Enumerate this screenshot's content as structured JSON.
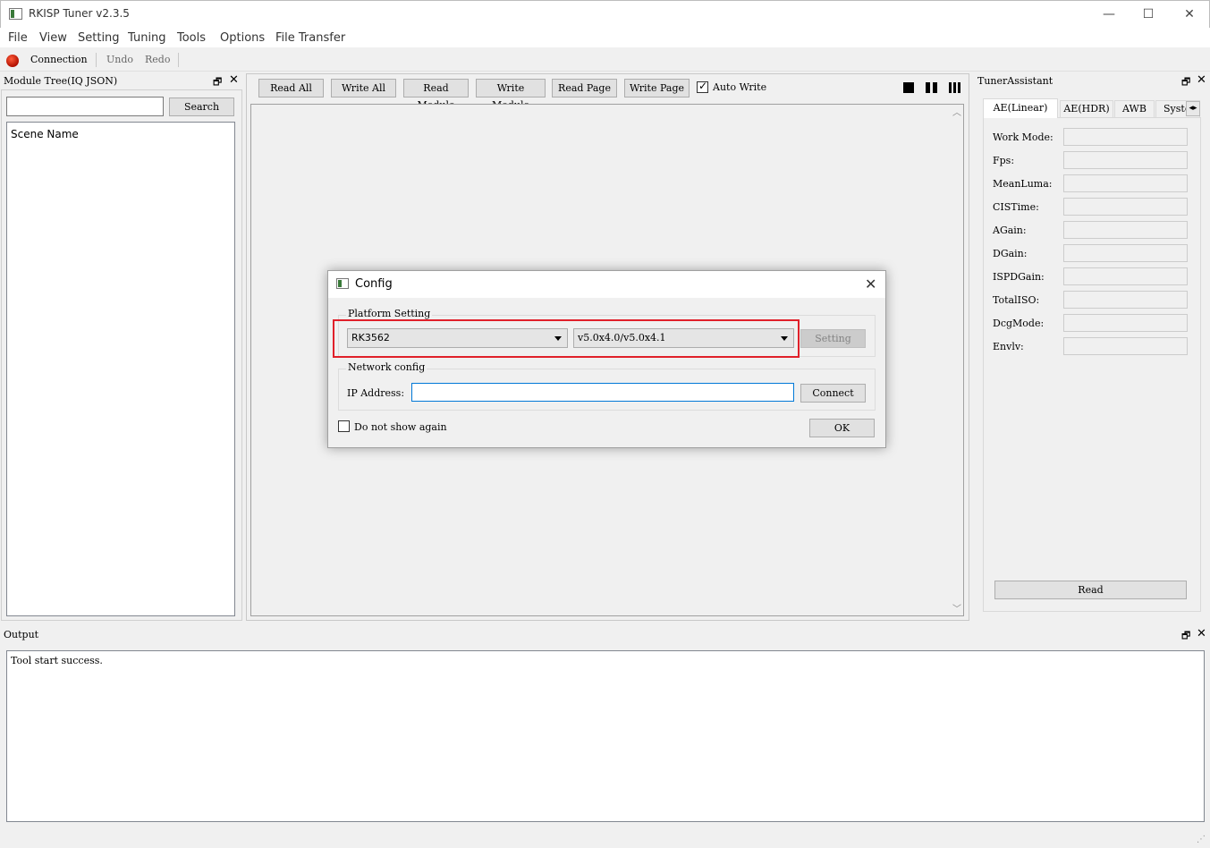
{
  "window": {
    "title": "RKISP Tuner v2.3.5",
    "controls": [
      "—",
      "☐",
      "✕"
    ]
  },
  "menu": [
    "File",
    "View",
    "Setting",
    "Tuning",
    "Tools",
    "Options",
    "File Transfer"
  ],
  "toolbar": {
    "connection_label": "Connection",
    "undo_label": "Undo",
    "redo_label": "Redo",
    "status_color": "#d21b00"
  },
  "module_tree": {
    "title": "Module Tree(IQ JSON)",
    "search_value": "",
    "search_button": "Search",
    "header": "Scene Name"
  },
  "center": {
    "buttons": [
      "Read All",
      "Write All",
      "Read Module",
      "Write Module",
      "Read Page",
      "Write Page"
    ],
    "auto_write_label": "Auto Write",
    "auto_write_checked": true
  },
  "assistant": {
    "title": "TunerAssistant",
    "tabs": [
      "AE(Linear)",
      "AE(HDR)",
      "AWB",
      "Syste"
    ],
    "fields": [
      "Work Mode:",
      "Fps:",
      "MeanLuma:",
      "CISTime:",
      "AGain:",
      "DGain:",
      "ISPDGain:",
      "TotalISO:",
      "DcgMode:",
      "Envlv:"
    ],
    "read_button": "Read"
  },
  "output": {
    "title": "Output",
    "text": "Tool start success."
  },
  "dialog": {
    "title": "Config",
    "platform_group": "Platform Setting",
    "platform_value": "RK3562",
    "version_value": "v5.0x4.0/v5.0x4.1",
    "setting_button": "Setting",
    "network_group": "Network config",
    "ip_label": "IP Address:",
    "ip_value": "",
    "connect_button": "Connect",
    "dont_show_label": "Do not show again",
    "ok_button": "OK",
    "highlight_color": "#e0202a"
  }
}
